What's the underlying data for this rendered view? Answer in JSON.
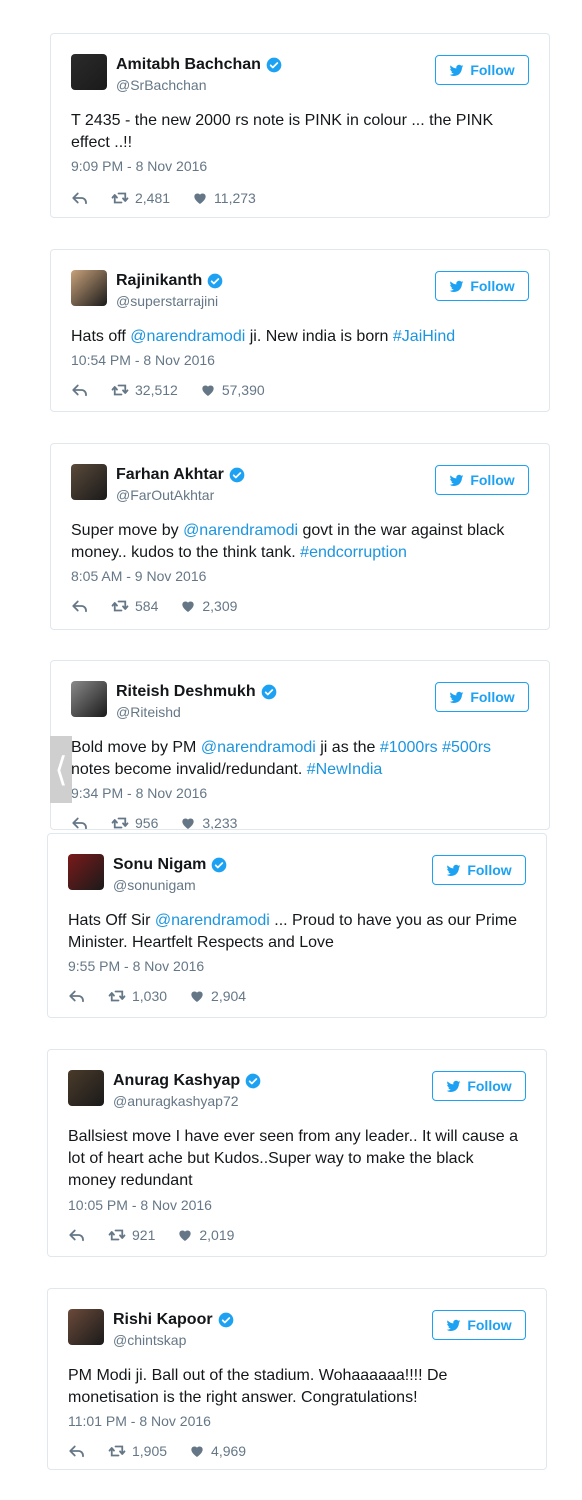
{
  "follow_label": "Follow",
  "colors": {
    "link": "#1b95e0",
    "accent": "#1da1f2",
    "muted": "#657786",
    "border": "#e1e8ed"
  },
  "icons": [
    "reply-icon",
    "retweet-icon",
    "heart-icon",
    "verified-icon",
    "twitter-bird-icon",
    "chevron-left-icon"
  ],
  "tweets": [
    {
      "name": "Amitabh Bachchan",
      "handle": "@SrBachchan",
      "parts": [
        {
          "t": "T 2435 - the new 2000 rs note is PINK in colour ... the PINK effect ..!!",
          "link": false
        }
      ],
      "time": "9:09 PM - 8 Nov 2016",
      "retweets": "2,481",
      "likes": "11,273"
    },
    {
      "name": "Rajinikanth",
      "handle": "@superstarrajini",
      "parts": [
        {
          "t": "Hats off ",
          "link": false
        },
        {
          "t": "@narendramodi",
          "link": true
        },
        {
          "t": " ji. New india is born ",
          "link": false
        },
        {
          "t": "#JaiHind",
          "link": true
        }
      ],
      "time": "10:54 PM - 8 Nov 2016",
      "retweets": "32,512",
      "likes": "57,390"
    },
    {
      "name": "Farhan Akhtar",
      "handle": "@FarOutAkhtar",
      "parts": [
        {
          "t": "Super move by ",
          "link": false
        },
        {
          "t": "@narendramodi",
          "link": true
        },
        {
          "t": " govt in the war against black money.. kudos to the think tank. ",
          "link": false
        },
        {
          "t": "#endcorruption",
          "link": true
        }
      ],
      "time": "8:05 AM - 9 Nov 2016",
      "retweets": "584",
      "likes": "2,309"
    },
    {
      "name": "Riteish Deshmukh",
      "handle": "@Riteishd",
      "parts": [
        {
          "t": "Bold move by PM ",
          "link": false
        },
        {
          "t": "@narendramodi",
          "link": true
        },
        {
          "t": " ji as the ",
          "link": false
        },
        {
          "t": "#1000rs",
          "link": true
        },
        {
          "t": " ",
          "link": false
        },
        {
          "t": "#500rs",
          "link": true
        },
        {
          "t": " notes become invalid/redundant. ",
          "link": false
        },
        {
          "t": "#NewIndia",
          "link": true
        }
      ],
      "time": "9:34 PM - 8 Nov 2016",
      "retweets": "956",
      "likes": "3,233"
    },
    {
      "name": "Sonu Nigam",
      "handle": "@sonunigam",
      "parts": [
        {
          "t": "Hats Off Sir ",
          "link": false
        },
        {
          "t": "@narendramodi",
          "link": true
        },
        {
          "t": " ... Proud to have you as our Prime Minister. Heartfelt Respects and Love",
          "link": false
        }
      ],
      "time": "9:55 PM - 8 Nov 2016",
      "retweets": "1,030",
      "likes": "2,904"
    },
    {
      "name": "Anurag Kashyap",
      "handle": "@anuragkashyap72",
      "parts": [
        {
          "t": "Ballsiest move I have ever seen from any leader.. It will cause a lot of heart ache but Kudos..Super way to make the black money redundant",
          "link": false
        }
      ],
      "time": "10:05 PM - 8 Nov 2016",
      "retweets": "921",
      "likes": "2,019"
    },
    {
      "name": "Rishi Kapoor",
      "handle": "@chintskap",
      "parts": [
        {
          "t": "PM Modi ji. Ball out of the stadium. Wohaaaaaa!!!! De monetisation is the right answer. Congratulations!",
          "link": false
        }
      ],
      "time": "11:01 PM - 8 Nov 2016",
      "retweets": "1,905",
      "likes": "4,969"
    }
  ]
}
